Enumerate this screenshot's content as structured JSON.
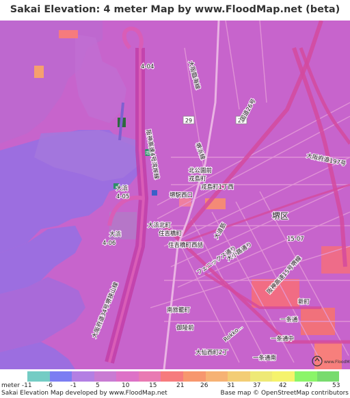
{
  "title": "Sakai Elevation: 4 meter Map by www.FloodMap.net (beta)",
  "map": {
    "place_labels": [
      "大浜北町",
      "住吉橋町",
      "住吉橋町西詰",
      "堺駅西口",
      "北公園前",
      "戎島町",
      "戎島町1丁西",
      "南旅籠町",
      "御陵前",
      "大仙西町2丁",
      "一条通",
      "一条通中",
      "一条通南",
      "新町",
      "大浜",
      "大浜",
      "堺区",
      "フェニックス通り",
      "大小路通り",
      "大道筋",
      "阪神高速15号堺線",
      "阪神高速4号湾岸線",
      "大阪府道197号",
      "大阪臨海線",
      "国道26号",
      "大阪府道34号堺狭山線",
      "Rokko...",
      "堺浜線",
      "4-04",
      "4-05",
      "4-06",
      "15-07",
      "29",
      "26",
      "堺市",
      "湾岸"
    ]
  },
  "legend": {
    "colors": [
      "#74ccc4",
      "#7b7df2",
      "#b37fe3",
      "#c97bd3",
      "#dd72c7",
      "#e97ab3",
      "#f67b7d",
      "#f7976e",
      "#f6b274",
      "#f3cd75",
      "#eee976",
      "#f5f36c",
      "#8bf569",
      "#78db6e"
    ],
    "ticks": [
      "meter -11",
      "-6",
      "-1",
      "5",
      "10",
      "15",
      "21",
      "26",
      "31",
      "37",
      "42",
      "47",
      "53"
    ],
    "footer_left": "Sakai Elevation Map developed by www.FloodMap.net",
    "footer_right": "Base map © OpenStreetMap contributors"
  }
}
